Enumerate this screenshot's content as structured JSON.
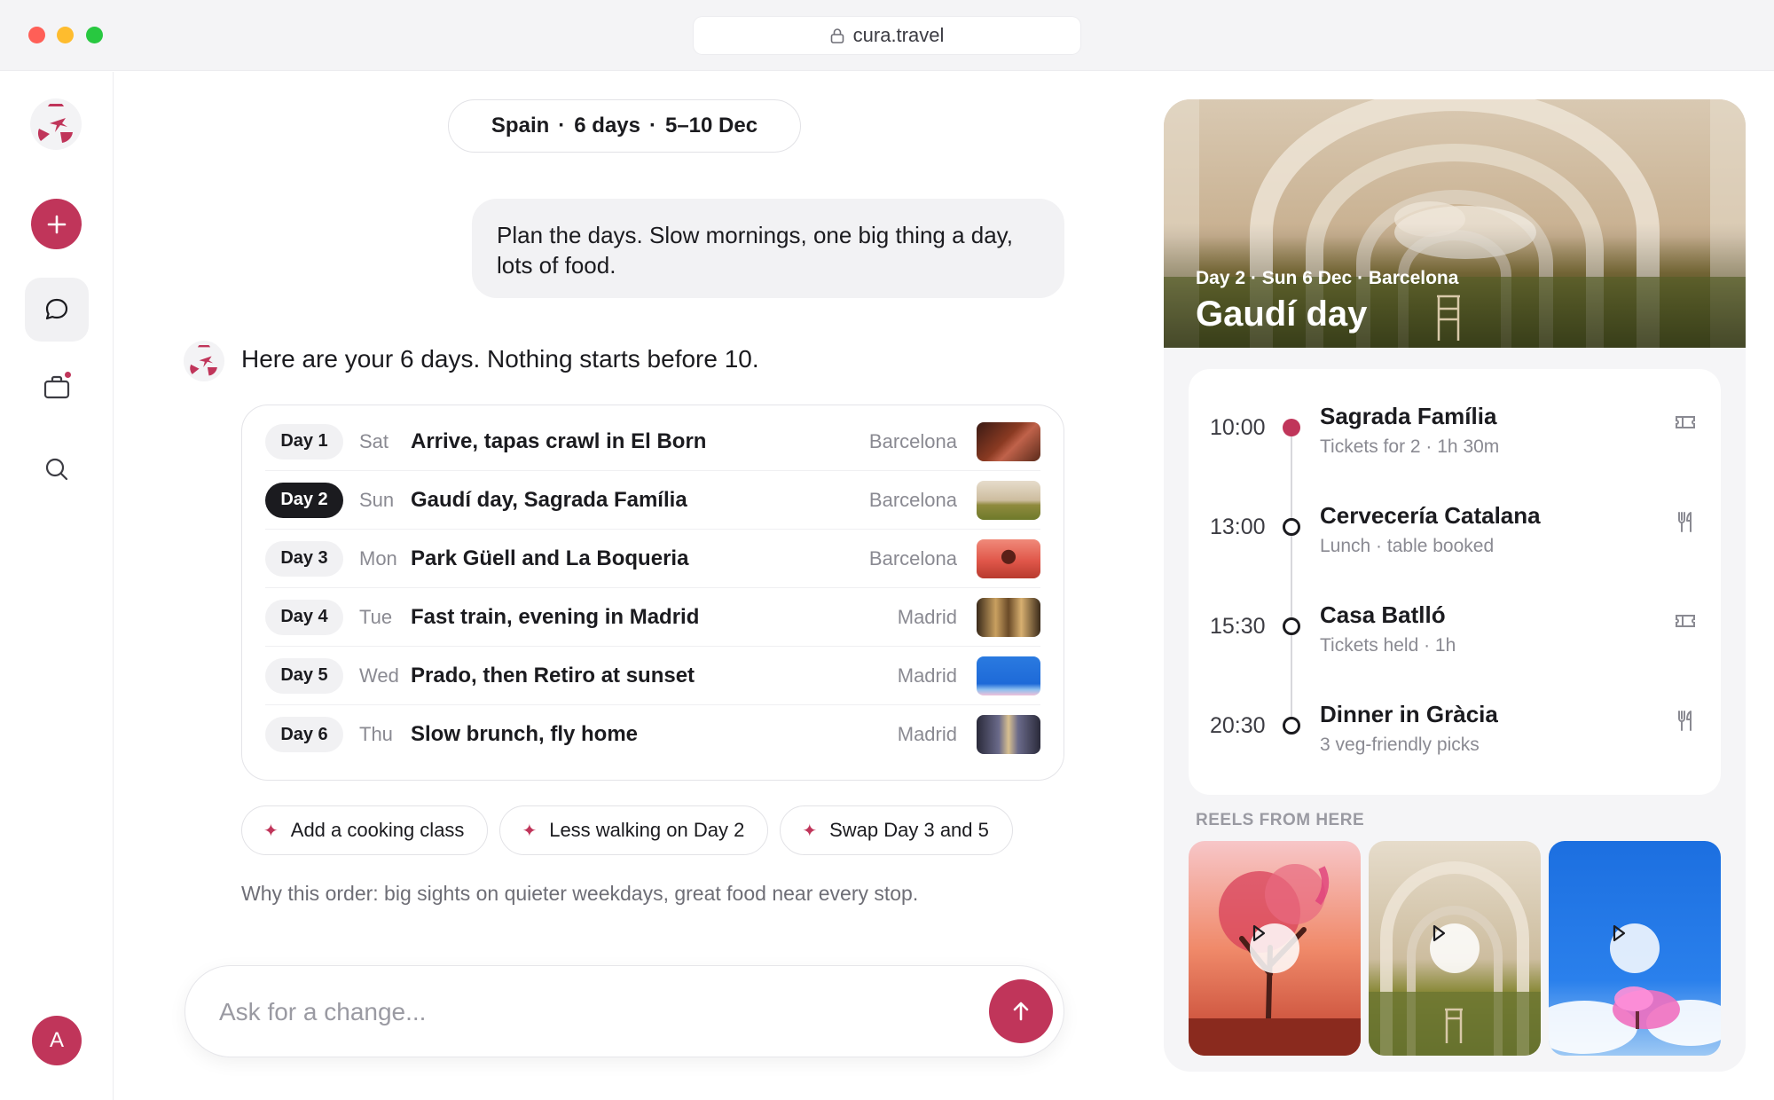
{
  "browser": {
    "url": "cura.travel"
  },
  "trip": {
    "country": "Spain",
    "duration": "6 days",
    "separator": "·",
    "dates": "5–10 Dec"
  },
  "chat": {
    "user_message": "Plan the days. Slow mornings, one big thing a day, lots of food.",
    "assistant_message": "Here are your 6 days. Nothing starts before 10.",
    "days": [
      {
        "day": "Day 1",
        "weekday": "Sat",
        "title": "Arrive, tapas crawl in El Born",
        "city": "Barcelona",
        "active": false
      },
      {
        "day": "Day 2",
        "weekday": "Sun",
        "title": "Gaudí day, Sagrada Família",
        "city": "Barcelona",
        "active": true
      },
      {
        "day": "Day 3",
        "weekday": "Mon",
        "title": "Park Güell and La Boqueria",
        "city": "Barcelona",
        "active": false
      },
      {
        "day": "Day 4",
        "weekday": "Tue",
        "title": "Fast train, evening in Madrid",
        "city": "Madrid",
        "active": false
      },
      {
        "day": "Day 5",
        "weekday": "Wed",
        "title": "Prado, then Retiro at sunset",
        "city": "Madrid",
        "active": false
      },
      {
        "day": "Day 6",
        "weekday": "Thu",
        "title": "Slow brunch, fly home",
        "city": "Madrid",
        "active": false
      }
    ],
    "suggestions": [
      "Add a cooking class",
      "Less walking on Day 2",
      "Swap Day 3 and 5"
    ],
    "explanation": "Why this order: big sights on quieter weekdays, great food near every stop.",
    "composer_placeholder": "Ask for a change..."
  },
  "sidebar": {
    "avatar_initial": "A"
  },
  "panel": {
    "hero_subtitle": "Day 2 · Sun 6 Dec · Barcelona",
    "hero_title": "Gaudí day",
    "schedule": [
      {
        "time": "10:00",
        "name": "Sagrada Família",
        "detail": "Tickets for 2 · 1h 30m",
        "icon": "ticket-icon",
        "current": true
      },
      {
        "time": "13:00",
        "name": "Cervecería Catalana",
        "detail": "Lunch · table booked",
        "icon": "fork-knife-icon",
        "current": false
      },
      {
        "time": "15:30",
        "name": "Casa Batlló",
        "detail": "Tickets held · 1h",
        "icon": "ticket-icon",
        "current": false
      },
      {
        "time": "20:30",
        "name": "Dinner in Gràcia",
        "detail": "3 veg-friendly picks",
        "icon": "fork-knife-icon",
        "current": false
      }
    ],
    "reels_label": "REELS FROM HERE"
  },
  "colors": {
    "accent": "#c0355a",
    "text": "#1b1b1f",
    "muted": "#8a8a92",
    "panel_bg": "#f5f5f7"
  }
}
